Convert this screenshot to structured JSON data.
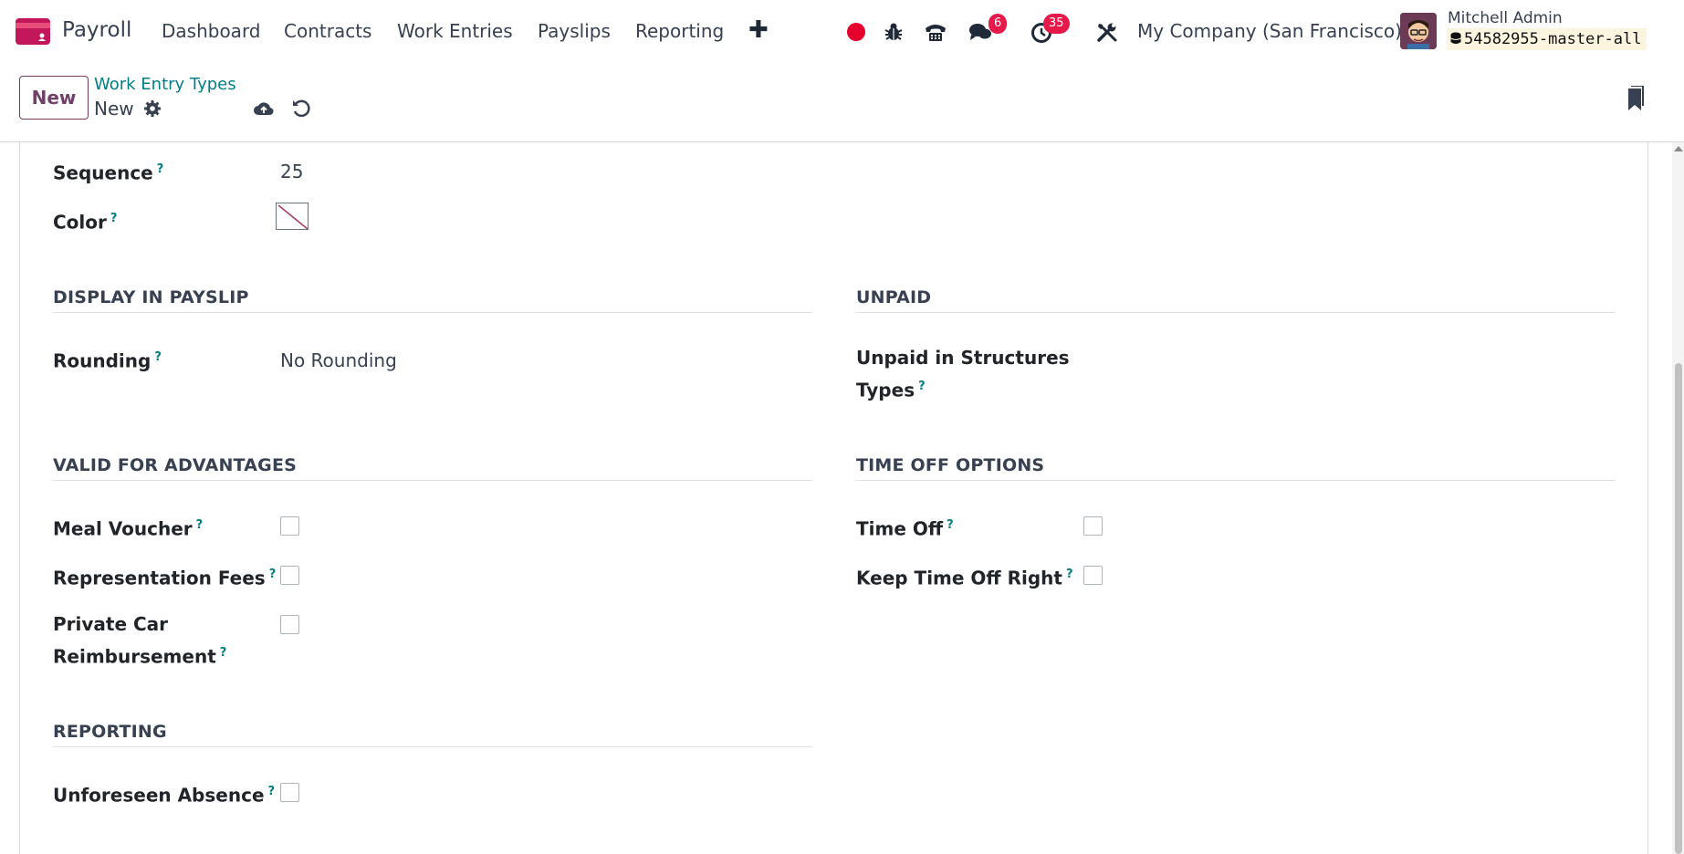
{
  "navbar": {
    "app_name": "Payroll",
    "menu": [
      "Dashboard",
      "Contracts",
      "Work Entries",
      "Payslips",
      "Reporting"
    ],
    "messages_count": "6",
    "activities_count": "35",
    "company": "My Company (San Francisco)",
    "user_name": "Mitchell Admin",
    "database": "54582955-master-all"
  },
  "control_panel": {
    "new_button": "New",
    "breadcrumb_parent": "Work Entry Types",
    "breadcrumb_current": "New"
  },
  "form": {
    "sequence": {
      "label": "Sequence",
      "tip": "?",
      "value": "25"
    },
    "color": {
      "label": "Color",
      "tip": "?"
    },
    "display_in_payslip": {
      "title": "DISPLAY IN PAYSLIP",
      "rounding": {
        "label": "Rounding",
        "tip": "?",
        "value": "No Rounding"
      }
    },
    "unpaid": {
      "title": "UNPAID",
      "unpaid_line1": "Unpaid in Structures",
      "unpaid_line2": "Types",
      "tip": "?"
    },
    "valid_for_advantages": {
      "title": "VALID FOR ADVANTAGES",
      "meal_voucher": "Meal Voucher",
      "representation_fees": "Representation Fees",
      "private_car_line1": "Private Car",
      "private_car_line2": "Reimbursement",
      "tip": "?"
    },
    "time_off_options": {
      "title": "TIME OFF OPTIONS",
      "time_off": "Time Off",
      "keep_time_off_right": "Keep Time Off Right",
      "tip": "?"
    },
    "reporting": {
      "title": "REPORTING",
      "unforeseen_absence": "Unforeseen Absence",
      "tip": "?"
    }
  },
  "colors": {
    "brand": "#71406a",
    "link": "#017e84",
    "badge": "#e6194b"
  }
}
